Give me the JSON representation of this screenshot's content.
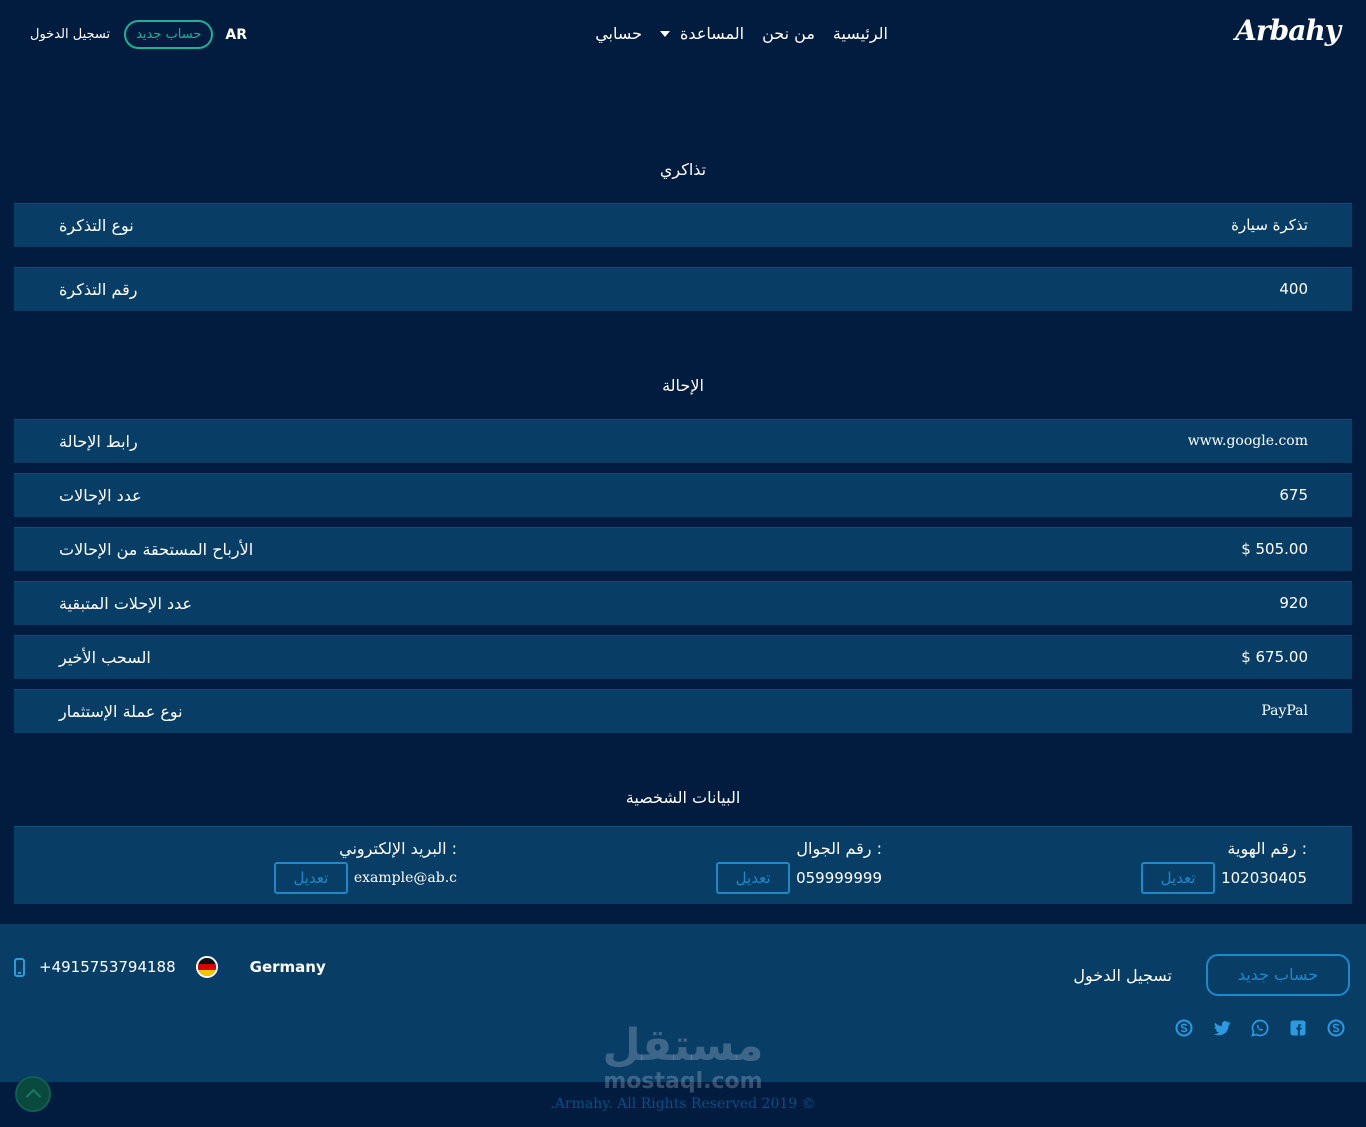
{
  "header": {
    "logo": "Arbahy",
    "nav": {
      "home": "الرئيسية",
      "about": "من نحن",
      "help": "المساعدة",
      "account": "حسابي"
    },
    "lang": "AR",
    "new_account": "حساب جديد",
    "login": "تسجيل الدخول"
  },
  "tickets": {
    "title": "تذاكري",
    "rows": [
      {
        "label": "نوع التذكرة",
        "value": "تذكرة سيارة"
      },
      {
        "label": "رقم التذكرة",
        "value": "400"
      }
    ]
  },
  "referral": {
    "title": "الإحالة",
    "rows": [
      {
        "label": "رابط الإحالة",
        "value": "www.google.com"
      },
      {
        "label": "عدد الإحالات",
        "value": "675"
      },
      {
        "label": "الأرباح المستحقة من الإحالات",
        "value": "$  505.00"
      },
      {
        "label": "عدد الإحلات المتبقية",
        "value": "920"
      },
      {
        "label": "السحب الأخير",
        "value": "$  675.00"
      },
      {
        "label": "نوع عملة الإستثمار",
        "value": "PayPal"
      }
    ]
  },
  "personal": {
    "title": "البيانات الشخصية",
    "fields": {
      "id": {
        "label": "رقم الهوية :",
        "value": "102030405",
        "edit": "تعديل"
      },
      "mobile": {
        "label": "رقم الجوال :",
        "value": "059999999",
        "edit": "تعديل"
      },
      "email": {
        "label": "البريد الإلكتروني :",
        "value": "example@ab.c",
        "edit": "تعديل"
      }
    }
  },
  "footer": {
    "phone": "+4915753794188",
    "country": "Germany",
    "new_account": "حساب جديد",
    "login": "تسجيل الدخول",
    "socials": [
      "skype-icon",
      "facebook-icon",
      "whatsapp-icon",
      "twitter-icon",
      "skype-icon"
    ],
    "copyright": ".Armahy. All Rights Reserved 2019 ©"
  },
  "watermark": {
    "ar": "مستقل",
    "en": "mostaql.com"
  },
  "colors": {
    "background": "#021c3f",
    "row": "#083e66",
    "accent": "#1e88c8",
    "green": "#1ab394"
  }
}
